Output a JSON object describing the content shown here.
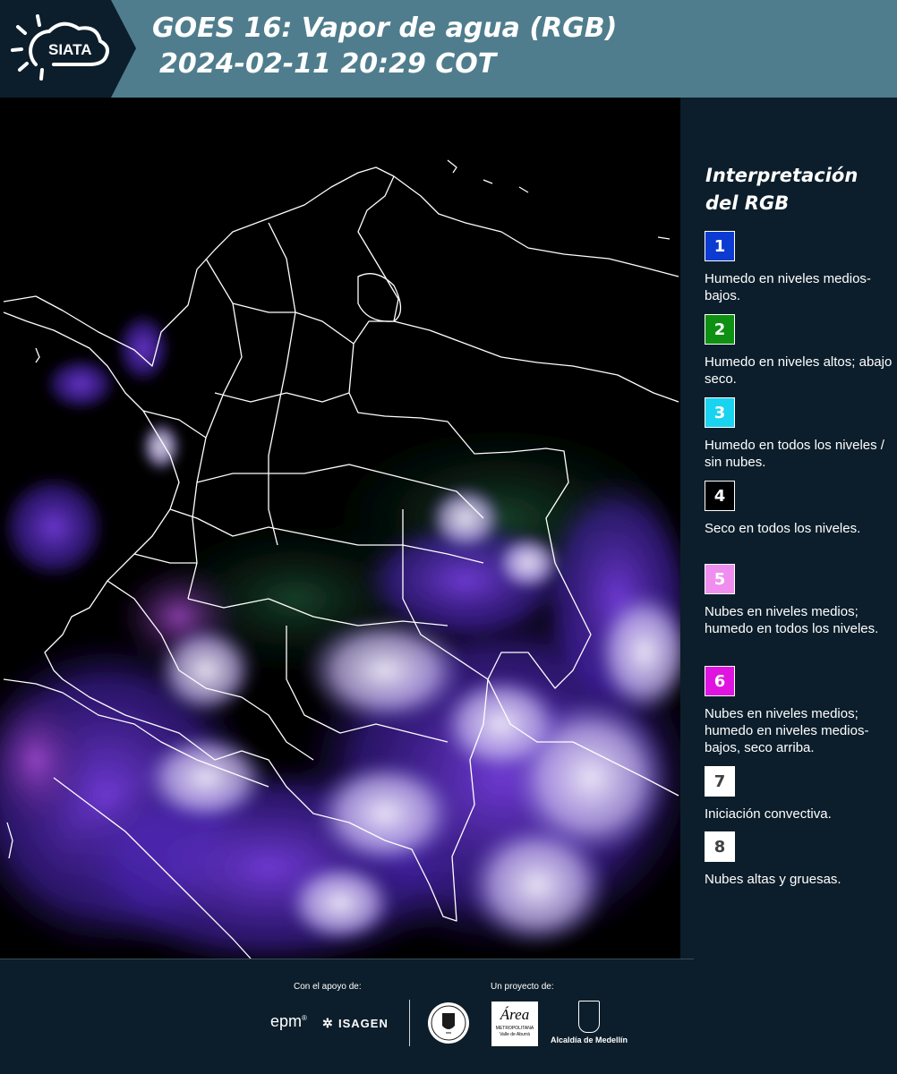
{
  "header": {
    "logo_text": "SIATA",
    "title_line1": "GOES 16: Vapor de agua (RGB)",
    "title_line2": "2024-02-11 20:29 COT",
    "colors": {
      "bar": "#4f7d8d",
      "logo_panel": "#0c1e2b"
    }
  },
  "legend": {
    "title": "Interpretación del RGB",
    "items": [
      {
        "number": "1",
        "color": "#0b3bd1",
        "text_color": "#ffffff",
        "label": "Humedo en niveles medios-bajos."
      },
      {
        "number": "2",
        "color": "#0e9013",
        "text_color": "#ffffff",
        "label": "Humedo en niveles altos; abajo seco."
      },
      {
        "number": "3",
        "color": "#19d3f0",
        "text_color": "#ffffff",
        "label": "Humedo en todos los niveles / sin nubes."
      },
      {
        "number": "4",
        "color": "#000000",
        "text_color": "#ffffff",
        "label": "Seco en todos los niveles."
      },
      {
        "number": "5",
        "color": "#f08ef0",
        "text_color": "#ffffff",
        "label": "Nubes en niveles medios; humedo en todos los niveles."
      },
      {
        "number": "6",
        "color": "#e014e0",
        "text_color": "#ffffff",
        "label": "Nubes en niveles medios; humedo en niveles medios-bajos, seco arriba."
      },
      {
        "number": "7",
        "color": "#ffffff",
        "text_color": "#404040",
        "label": "Iniciación convectiva."
      },
      {
        "number": "8",
        "color": "#ffffff",
        "text_color": "#404040",
        "label": "Nubes altas y gruesas."
      }
    ]
  },
  "footer": {
    "support_caption": "Con el apoyo de:",
    "project_caption": "Un proyecto de:",
    "epm": "epm",
    "epm_mark": "®",
    "isagen": "ISAGEN",
    "area_word": "Área",
    "area_small1": "METROPOLITANA",
    "area_small2": "Valle de Aburrá",
    "medellin": "Alcaldía de Medellín"
  },
  "map": {
    "icons": [
      "satellite-imagery",
      "country-boundaries"
    ]
  }
}
